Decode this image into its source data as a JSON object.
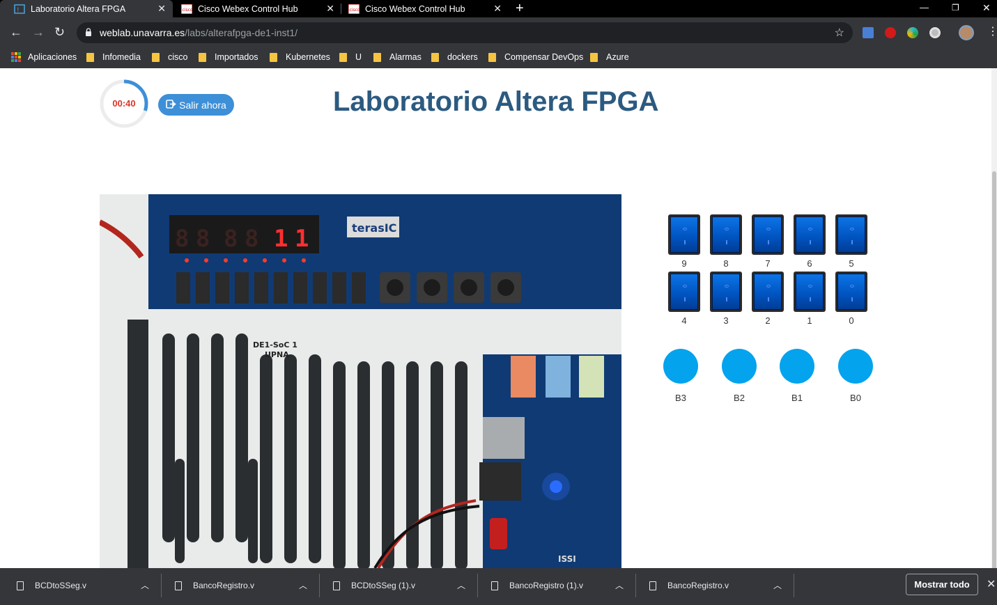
{
  "tabs": [
    {
      "label": "Laboratorio Altera FPGA",
      "active": true
    },
    {
      "label": "Cisco Webex Control Hub",
      "active": false
    },
    {
      "label": "Cisco Webex Control Hub",
      "active": false
    }
  ],
  "toolbar": {
    "url_host": "weblab.unavarra.es",
    "url_path": "/labs/alterafpga-de1-inst1/"
  },
  "bookmarks": [
    "Aplicaciones",
    "Infomedia",
    "cisco",
    "Importados",
    "Kubernetes",
    "U",
    "Alarmas",
    "dockers",
    "Compensar DevOps",
    "Azure"
  ],
  "page": {
    "timer": "00:40",
    "timer_progress": 0.3,
    "exit_label": "Salir ahora",
    "title": "Laboratorio Altera FPGA"
  },
  "switches": {
    "row1": [
      "9",
      "8",
      "7",
      "6",
      "5"
    ],
    "row2": [
      "4",
      "3",
      "2",
      "1",
      "0"
    ]
  },
  "push_buttons": [
    "B3",
    "B2",
    "B1",
    "B0"
  ],
  "downloads": [
    "BCDtoSSeg.v",
    "BancoRegistro.v",
    "BCDtoSSeg (1).v",
    "BancoRegistro (1).v",
    "BancoRegistro.v"
  ],
  "shelf": {
    "show_all": "Mostrar todo"
  },
  "colors": {
    "accent": "#3d8fd8",
    "title": "#2c5a80",
    "timer_text": "#d9362b",
    "button": "#03a3ee"
  }
}
